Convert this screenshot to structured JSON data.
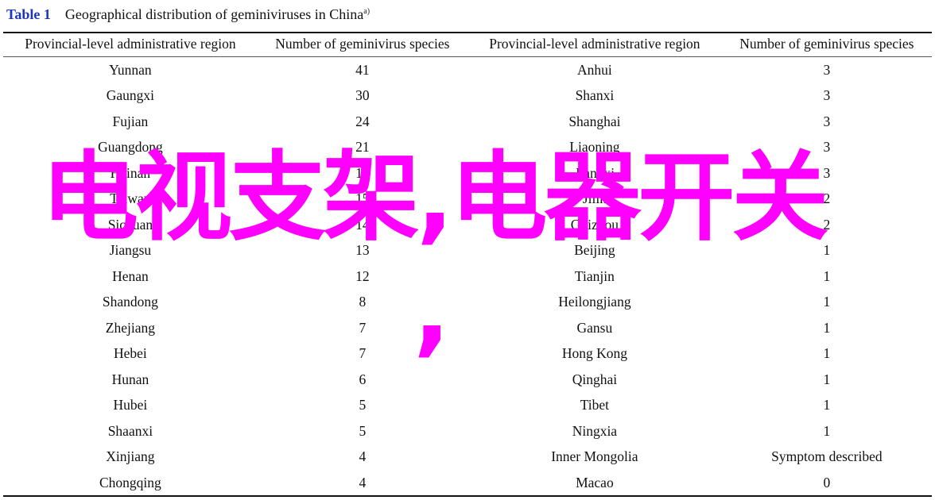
{
  "caption": {
    "label": "Table 1",
    "title": "Geographical distribution of geminiviruses in China",
    "note": "a)"
  },
  "headers": [
    "Provincial-level administrative region",
    "Number of geminivirus species",
    "Provincial-level administrative region",
    "Number of geminivirus species"
  ],
  "rows": [
    [
      "Yunnan",
      "41",
      "Anhui",
      "3"
    ],
    [
      "Gaungxi",
      "30",
      "Shanxi",
      "3"
    ],
    [
      "Fujian",
      "24",
      "Shanghai",
      "3"
    ],
    [
      "Guangdong",
      "21",
      "Liaoning",
      "3"
    ],
    [
      "Hainan",
      "17",
      "Jiangxi",
      "3"
    ],
    [
      "Taiwan",
      "15",
      "Jilin",
      "2"
    ],
    [
      "Sichuan",
      "14",
      "Guizhou",
      "2"
    ],
    [
      "Jiangsu",
      "13",
      "Beijing",
      "1"
    ],
    [
      "Henan",
      "12",
      "Tianjin",
      "1"
    ],
    [
      "Shandong",
      "8",
      "Heilongjiang",
      "1"
    ],
    [
      "Zhejiang",
      "7",
      "Gansu",
      "1"
    ],
    [
      "Hebei",
      "7",
      "Hong Kong",
      "1"
    ],
    [
      "Hunan",
      "6",
      "Qinghai",
      "1"
    ],
    [
      "Hubei",
      "5",
      "Tibet",
      "1"
    ],
    [
      "Shaanxi",
      "5",
      "Ningxia",
      "1"
    ],
    [
      "Xinjiang",
      "4",
      "Inner Mongolia",
      "Symptom described"
    ],
    [
      "Chongqing",
      "4",
      "Macao",
      "0"
    ]
  ],
  "overlay": {
    "text": "电视支架,电器开关",
    "text2": ",",
    "color": "#ff00ff"
  }
}
